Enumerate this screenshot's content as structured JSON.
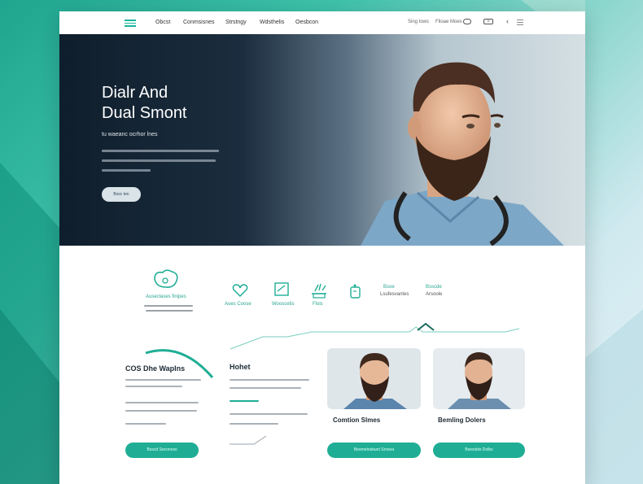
{
  "colors": {
    "accent": "#1fae95",
    "hero_dark": "#0f1e2c",
    "text_dark": "#1d2a33"
  },
  "nav": {
    "links": [
      "Obcst",
      "Conmsisnes",
      "Strstngy",
      "Wdsthelis",
      "Oesbcon"
    ],
    "right_links": [
      "Sing tows",
      "Flioae Moes"
    ],
    "toggle_label": "0",
    "chevron_icon": "‹"
  },
  "hero": {
    "title_line1": "Dialr And",
    "title_line2": "Dual Smont",
    "subtitle": "tu waeanc ocrhor lnes",
    "button_label": "Bssc ten"
  },
  "features": [
    {
      "label": "Auseclases finipes",
      "icon": "stethoscope-icon"
    },
    {
      "label": "Aoes Coose",
      "icon": "heart-icon"
    },
    {
      "label": "Wooscetis",
      "icon": "checkbox-icon"
    },
    {
      "label": "Flois",
      "icon": "hand-icon"
    },
    {
      "label": "Bsoe",
      "icon": "device-icon"
    },
    {
      "label": "Lsufesvantes",
      "icon": ""
    },
    {
      "label": "Bsscde",
      "icon": ""
    },
    {
      "label": "Arsoole",
      "icon": ""
    }
  ],
  "sections": {
    "left_title": "COS Dhe Waplns",
    "left_button": "Bsscd Seconess",
    "middle_title": "Hohet"
  },
  "cards": [
    {
      "name": "Comtion Slmes",
      "button": "Besmetosbunt Srosea"
    },
    {
      "name": "Bemling Dolers",
      "button": "Bsessbis Dolbs"
    }
  ]
}
